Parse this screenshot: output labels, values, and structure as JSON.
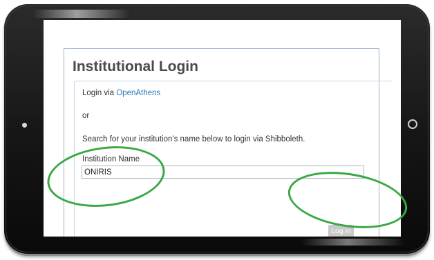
{
  "page": {
    "title": "Institutional Login",
    "openathens_prefix": "Login via ",
    "openathens_link": "OpenAthens",
    "or_text": "or",
    "search_instruction": "Search for your institution's name below to login via Shibboleth.",
    "institution_label": "Institution Name",
    "institution_value": "ONIRIS",
    "login_button": "Log in"
  },
  "colors": {
    "annotation": "#3aa843",
    "link": "#2a7ab8",
    "button_bg": "#c9c9c9"
  },
  "icons": {
    "camera": "camera-icon",
    "home": "home-button-icon"
  }
}
